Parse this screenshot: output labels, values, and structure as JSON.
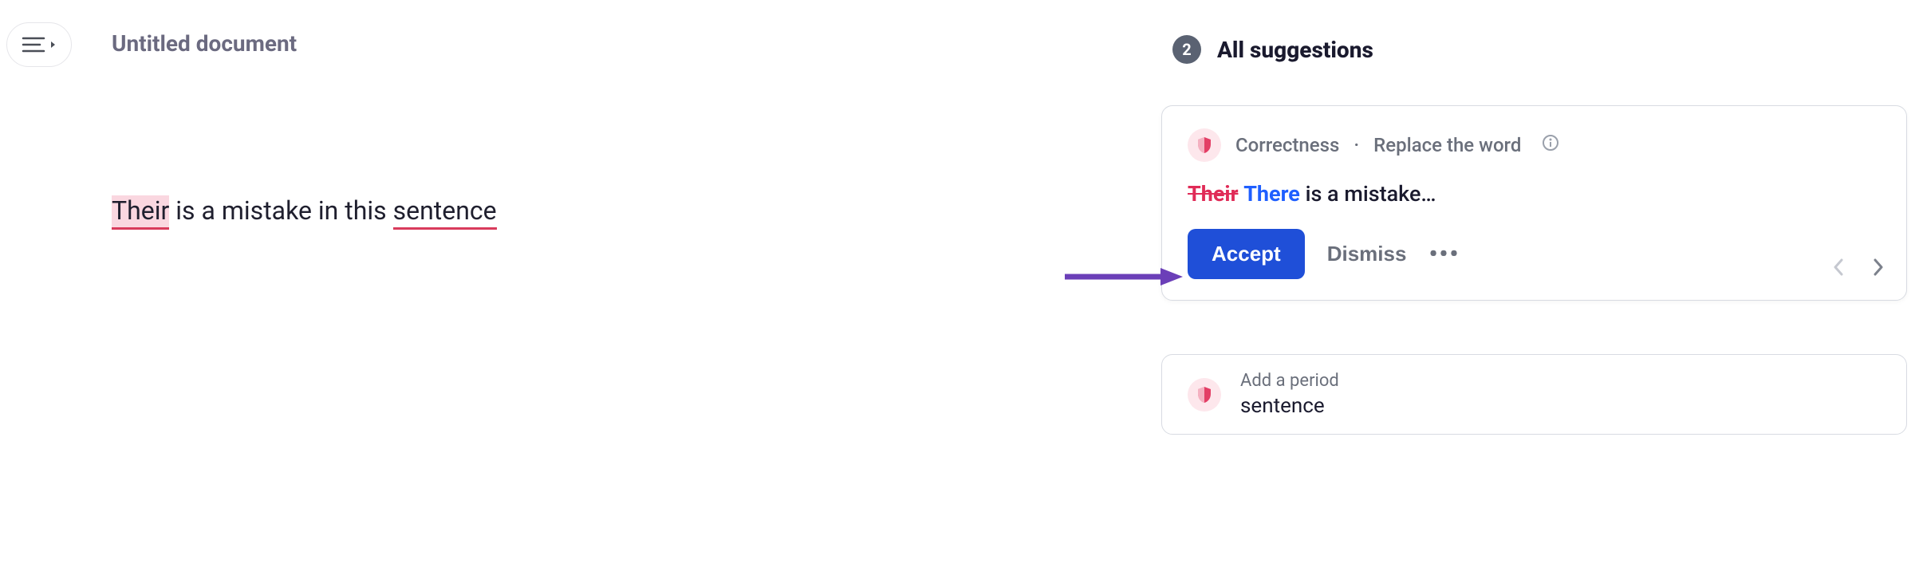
{
  "document": {
    "title": "Untitled document"
  },
  "editor": {
    "word_error": "Their",
    "mid": " is a mistake in this ",
    "word_underlined": "sentence"
  },
  "sidebar": {
    "count": "2",
    "title": "All suggestions"
  },
  "suggestion1": {
    "category": "Correctness",
    "sep": " · ",
    "hint": "Replace the word",
    "strike": "Their",
    "corrected": "There",
    "rest": " is a mistake…",
    "accept": "Accept",
    "dismiss": "Dismiss"
  },
  "suggestion2": {
    "title": "Add a period",
    "word": "sentence"
  }
}
